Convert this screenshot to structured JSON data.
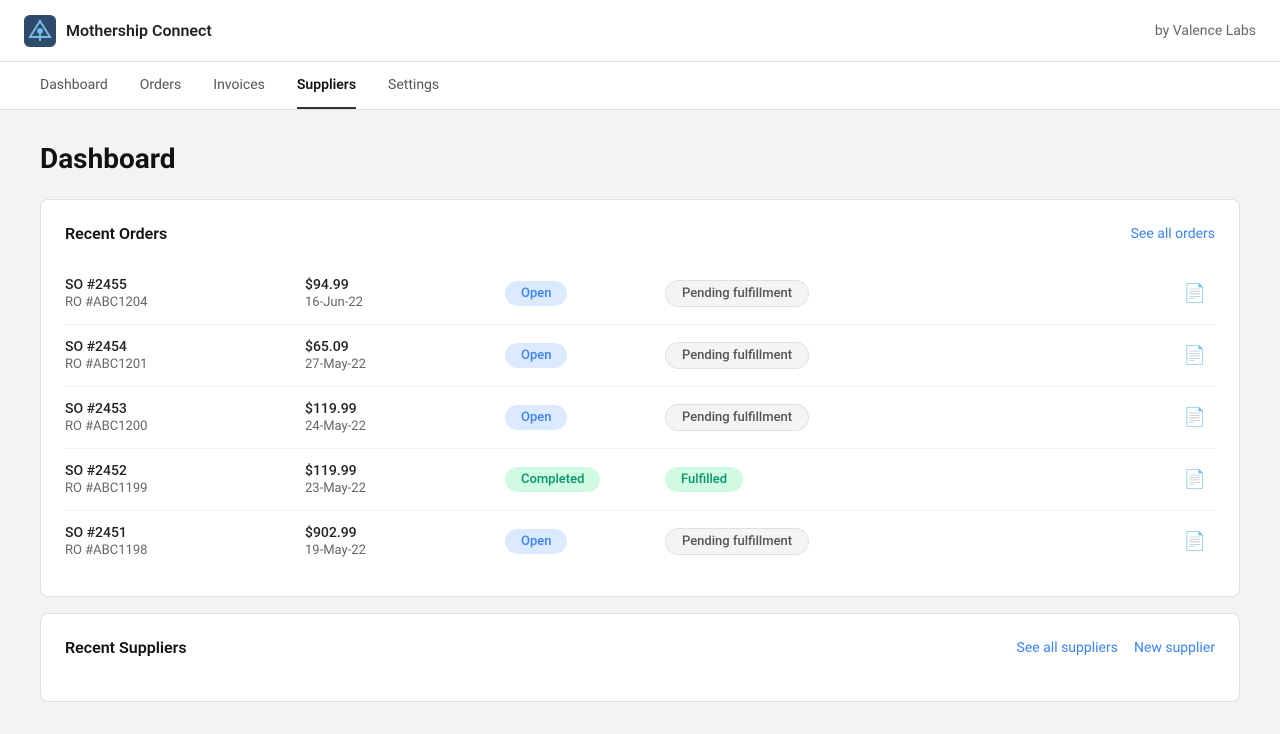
{
  "header": {
    "title": "Mothership Connect",
    "byline": "by Valence Labs",
    "logo_alt": "mothership-logo"
  },
  "nav": {
    "items": [
      {
        "label": "Dashboard",
        "active": false
      },
      {
        "label": "Orders",
        "active": false
      },
      {
        "label": "Invoices",
        "active": false
      },
      {
        "label": "Suppliers",
        "active": true
      },
      {
        "label": "Settings",
        "active": false
      }
    ]
  },
  "page": {
    "title": "Dashboard"
  },
  "recent_orders": {
    "section_title": "Recent Orders",
    "see_all_label": "See all orders",
    "orders": [
      {
        "so": "SO #2455",
        "ro": "RO #ABC1204",
        "amount": "$94.99",
        "date": "16-Jun-22",
        "status": "Open",
        "status_type": "open",
        "fulfillment": "Pending fulfillment",
        "fulfillment_type": "pending"
      },
      {
        "so": "SO #2454",
        "ro": "RO #ABC1201",
        "amount": "$65.09",
        "date": "27-May-22",
        "status": "Open",
        "status_type": "open",
        "fulfillment": "Pending fulfillment",
        "fulfillment_type": "pending"
      },
      {
        "so": "SO #2453",
        "ro": "RO #ABC1200",
        "amount": "$119.99",
        "date": "24-May-22",
        "status": "Open",
        "status_type": "open",
        "fulfillment": "Pending fulfillment",
        "fulfillment_type": "pending"
      },
      {
        "so": "SO #2452",
        "ro": "RO #ABC1199",
        "amount": "$119.99",
        "date": "23-May-22",
        "status": "Completed",
        "status_type": "completed",
        "fulfillment": "Fulfilled",
        "fulfillment_type": "fulfilled"
      },
      {
        "so": "SO #2451",
        "ro": "RO #ABC1198",
        "amount": "$902.99",
        "date": "19-May-22",
        "status": "Open",
        "status_type": "open",
        "fulfillment": "Pending fulfillment",
        "fulfillment_type": "pending"
      }
    ]
  },
  "recent_suppliers": {
    "section_title": "Recent Suppliers",
    "see_all_label": "See all suppliers",
    "new_label": "New supplier"
  }
}
